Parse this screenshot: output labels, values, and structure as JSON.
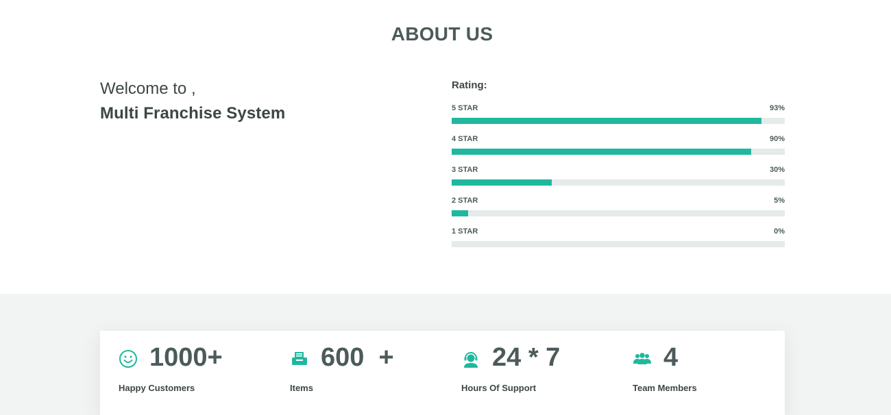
{
  "about": {
    "title": "ABOUT US"
  },
  "welcome": {
    "line1": "Welcome to ,",
    "line2": "Multi Franchise System"
  },
  "rating": {
    "label": "Rating:",
    "rows": [
      {
        "star": "5 STAR",
        "percent_text": "93%",
        "value": 93
      },
      {
        "star": "4 STAR",
        "percent_text": "90%",
        "value": 90
      },
      {
        "star": "3 STAR",
        "percent_text": "30%",
        "value": 30
      },
      {
        "star": "2 STAR",
        "percent_text": "5%",
        "value": 5
      },
      {
        "star": "1 STAR",
        "percent_text": "0%",
        "value": 0
      }
    ]
  },
  "stats": [
    {
      "icon": "smiley-icon",
      "number": "1000+",
      "label": "Happy Customers"
    },
    {
      "icon": "printer-icon",
      "number": "600  +",
      "label": "Items"
    },
    {
      "icon": "headset-support-icon",
      "number": "24 * 7",
      "label": "Hours Of Support"
    },
    {
      "icon": "team-icon",
      "number": "4",
      "label": "Team Members"
    }
  ],
  "colors": {
    "accent": "#1fb89e",
    "track": "#e5ebea",
    "text": "#4c5a5a",
    "band": "#f2f4f3"
  }
}
